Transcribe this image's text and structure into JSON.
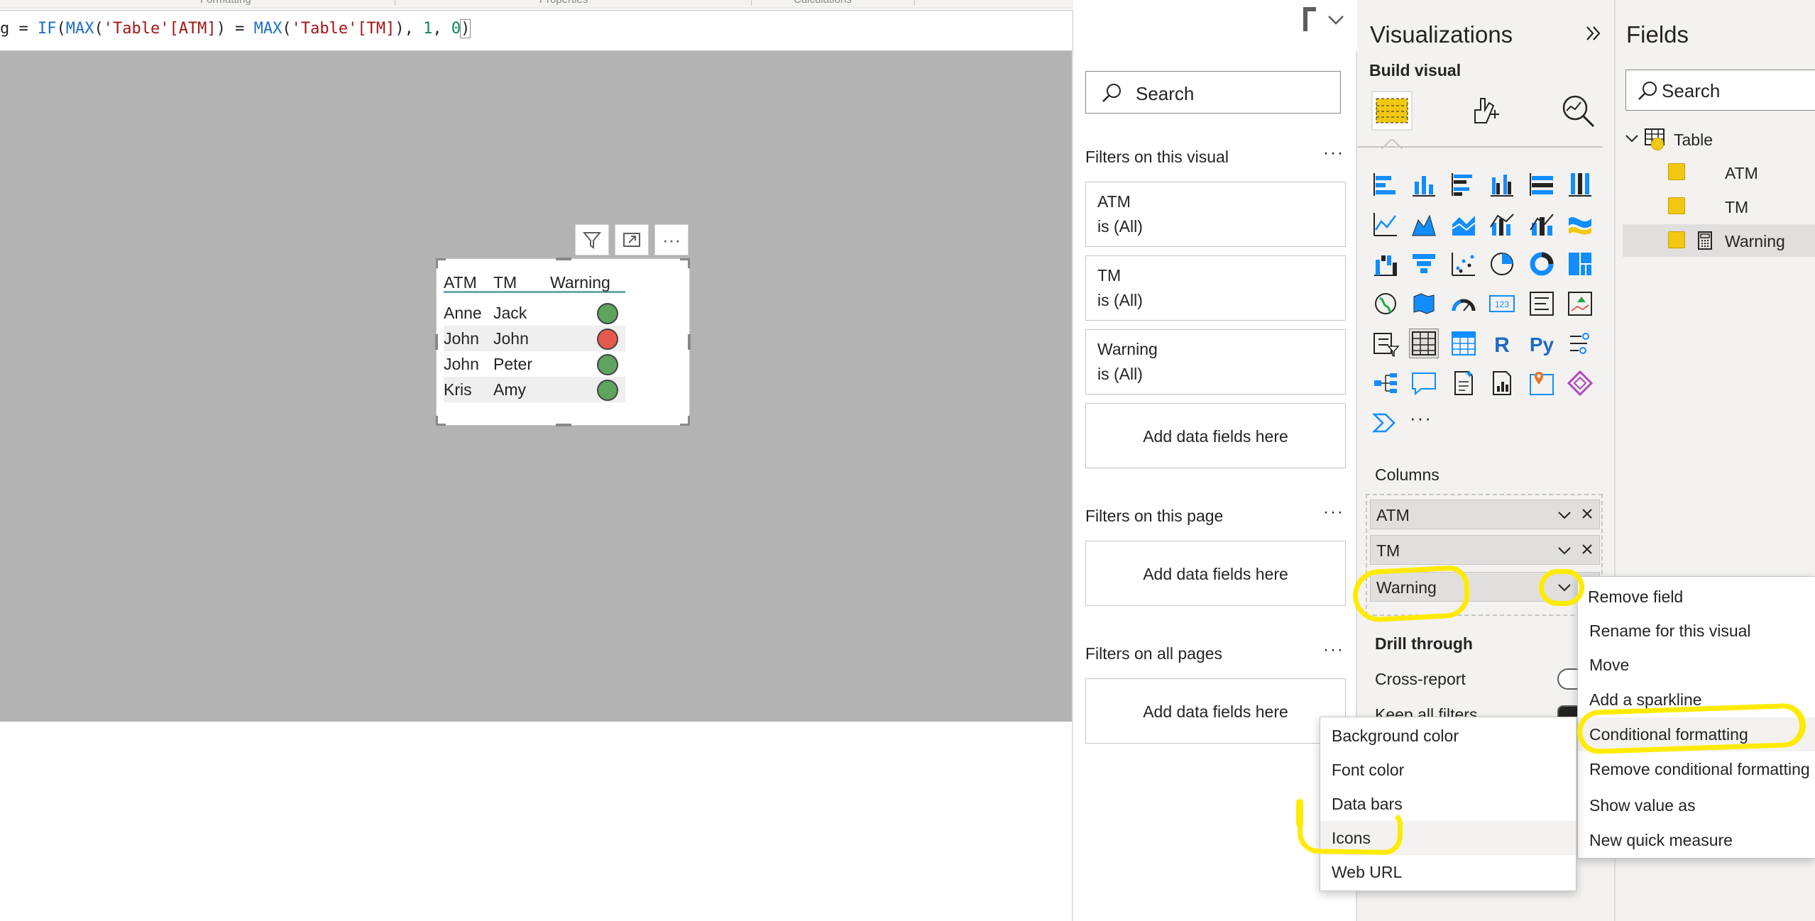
{
  "ribbon": {
    "tabs": [
      "Formatting",
      "Properties",
      "Calculations"
    ]
  },
  "formula": {
    "prefix": "g = ",
    "fn1": "IF",
    "p1": "(",
    "fn2": "MAX",
    "a1": "(",
    "s1": "'Table'[ATM]",
    "a2": ") = ",
    "fn3": "MAX",
    "a3": "(",
    "s2": "'Table'[TM]",
    "a4": "), ",
    "n1": "1",
    "a5": ", ",
    "n2": "0",
    "p2": ")"
  },
  "visual_header": {
    "more": "···"
  },
  "table_visual": {
    "columns": [
      "ATM",
      "TM",
      "Warning"
    ],
    "rows": [
      {
        "atm": "Anne",
        "tm": "Jack",
        "warning_color": "#5fa35f"
      },
      {
        "atm": "John",
        "tm": "John",
        "warning_color": "#e55a4e"
      },
      {
        "atm": "John",
        "tm": "Peter",
        "warning_color": "#5fa35f"
      },
      {
        "atm": "Kris",
        "tm": "Amy",
        "warning_color": "#5fa35f"
      }
    ]
  },
  "filters": {
    "search_placeholder": "Search",
    "on_visual_title": "Filters on this visual",
    "on_page_title": "Filters on this page",
    "on_all_title": "Filters on all pages",
    "more": "···",
    "cards": [
      {
        "field": "ATM",
        "state": "is (All)"
      },
      {
        "field": "TM",
        "state": "is (All)"
      },
      {
        "field": "Warning",
        "state": "is (All)"
      }
    ],
    "add_data": "Add data fields here"
  },
  "visualizations": {
    "title": "Visualizations",
    "build_visual": "Build visual",
    "r_label": "R",
    "py_label": "Py",
    "num_label": "123",
    "more": "···",
    "columns_label": "Columns",
    "wells": [
      "ATM",
      "TM",
      "Warning"
    ],
    "drill_through": "Drill through",
    "cross_report": "Cross-report",
    "keep_all_filters": "Keep all filters"
  },
  "fields": {
    "title": "Fields",
    "search_placeholder": "Search",
    "table_name": "Table",
    "items": [
      "ATM",
      "TM",
      "Warning"
    ]
  },
  "context_menu": {
    "items": [
      "Remove field",
      "Rename for this visual",
      "Move",
      "Add a sparkline",
      "Conditional formatting",
      "Remove conditional formatting",
      "Show value as",
      "New quick measure"
    ]
  },
  "submenu": {
    "items": [
      "Background color",
      "Font color",
      "Data bars",
      "Icons",
      "Web URL"
    ]
  },
  "colors": {
    "accent_yellow": "#f2c811",
    "highlight": "#ffeb00",
    "canvas_gray": "#b3b3b3"
  }
}
